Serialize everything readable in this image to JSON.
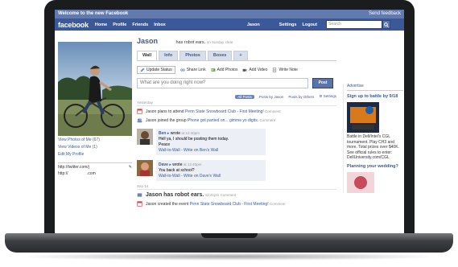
{
  "topbar": {
    "welcome": "Welcome to the new Facebook",
    "feedback": "Send feedback"
  },
  "nav": {
    "logo": "facebook",
    "home": "Home",
    "profile": "Profile",
    "friends": "Friends",
    "inbox": "Inbox",
    "user": "Jason",
    "settings": "Settings",
    "logout": "Logout",
    "search_placeholder": "Search"
  },
  "profile": {
    "name": "Jason",
    "status": "has robot ears.",
    "status_time": "on Sunday",
    "status_clear": "clear"
  },
  "tabs": [
    "Wall",
    "Info",
    "Photos",
    "Boxes",
    "+"
  ],
  "publisher": {
    "update_status": "Update Status",
    "share_link": "Share Link",
    "add_photos": "Add Photos",
    "add_video": "Add Video",
    "write_note": "Write Note",
    "placeholder": "What are you doing right now?",
    "post_button": "Post"
  },
  "filters": {
    "all_posts": "All Posts",
    "posts_by_jason": "Posts by Jason",
    "posts_by_others": "Posts by Others",
    "settings": "Settings"
  },
  "feed": {
    "yesterday": "Yesterday",
    "story1_pre": "Jason plans to attend",
    "story1_link": "Penn State Snowboard Club - First Meeting!",
    "story1_comment": "Comment",
    "story2_pre": "Jason joined the group",
    "story2_link": "Phone got partied on... gimme yo digits.",
    "story2_comment": "Comment",
    "post1_author": "Ben",
    "post1_verb": "wrote",
    "post1_time": "at 12:40pm",
    "post1_line1": "Hell ya, I should be posting them today.",
    "post1_line2": "Peace",
    "post1_link": "Wall-to-Wall - Write on Ben's Wall",
    "post2_author": "Dave",
    "post2_verb": "wrote",
    "post2_time": "at 12:40pm",
    "post2_line1": "You back at school?",
    "post2_link": "Wall-to-Wall - Write on Dave's Wall",
    "sep14": "Sep 14",
    "big_status": "Jason has robot ears.",
    "big_status_time": "12:41pm",
    "big_status_comment": "Comment",
    "story3_pre": "Jason created the event",
    "story3_link": "Penn State Snowboard Club - First Meeting!",
    "story3_comment": "Comment"
  },
  "left": {
    "view_photos": "View Photos of Me (67)",
    "view_videos": "View Videos of Me (1)",
    "edit_profile": "Edit My Profile",
    "twitter": "http://twitter.com/j",
    "url2": "http://",
    "url2_suffix": ".com"
  },
  "ads": {
    "header": "Advertise",
    "ad1_title": "Sign up to battle by 9/18",
    "ad1_body": "Battle in Dell/Intel's CGL tournament. Play CH3 and more. Total prizes over $40K. See official rules to enter: DellUniversity.com/CGL",
    "ad2_title": "Planning your wedding?"
  },
  "colors": {
    "brand_blue": "#3b5998",
    "top_strip": "#627aad"
  }
}
